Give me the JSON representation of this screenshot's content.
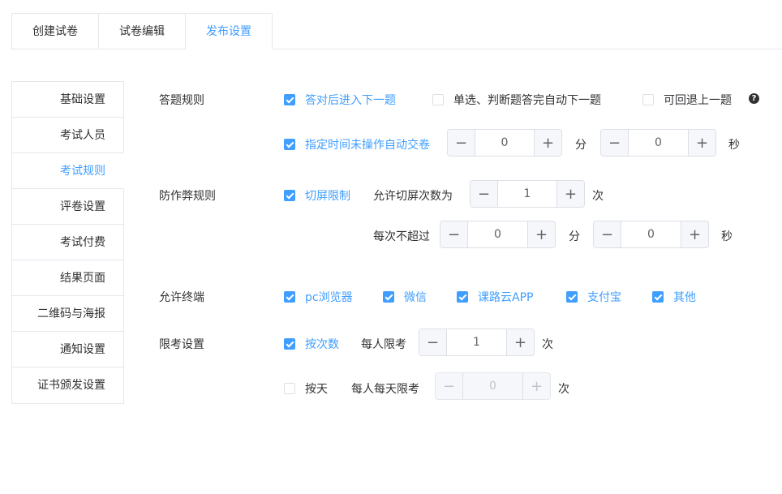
{
  "tabs": [
    {
      "label": "创建试卷"
    },
    {
      "label": "试卷编辑"
    },
    {
      "label": "发布设置"
    }
  ],
  "sidebar": {
    "items": [
      {
        "label": "基础设置"
      },
      {
        "label": "考试人员"
      },
      {
        "label": "考试规则"
      },
      {
        "label": "评卷设置"
      },
      {
        "label": "考试付费"
      },
      {
        "label": "结果页面"
      },
      {
        "label": "二维码与海报"
      },
      {
        "label": "通知设置"
      },
      {
        "label": "证书颁发设置"
      }
    ],
    "active_index": 2
  },
  "answer_rules": {
    "label": "答题规则",
    "next_after_correct": {
      "label": "答对后进入下一题",
      "checked": true
    },
    "auto_next": {
      "label": "单选、判断题答完自动下一题",
      "checked": false
    },
    "allow_back": {
      "label": "可回退上一题",
      "checked": false
    },
    "help_icon": "question-circle-icon",
    "auto_submit": {
      "label": "指定时间未操作自动交卷",
      "checked": true
    },
    "auto_submit_minutes": "0",
    "auto_submit_seconds": "0",
    "unit_min": "分",
    "unit_sec": "秒"
  },
  "anti_cheat": {
    "label": "防作弊规则",
    "switch_limit": {
      "label": "切屏限制",
      "checked": true
    },
    "allowed_text": "允许切屏次数为",
    "allowed_count": "1",
    "unit_times": "次",
    "each_max_text": "每次不超过",
    "each_minutes": "0",
    "each_seconds": "0",
    "unit_min": "分",
    "unit_sec": "秒"
  },
  "terminals": {
    "label": "允许终端",
    "options": [
      {
        "label": "pc浏览器",
        "checked": true
      },
      {
        "label": "微信",
        "checked": true
      },
      {
        "label": "课路云APP",
        "checked": true
      },
      {
        "label": "支付宝",
        "checked": true
      },
      {
        "label": "其他",
        "checked": true
      }
    ]
  },
  "limit": {
    "label": "限考设置",
    "by_count": {
      "label": "按次数",
      "checked": true
    },
    "per_person_text": "每人限考",
    "per_person_value": "1",
    "unit_times": "次",
    "by_day": {
      "label": "按天",
      "checked": false
    },
    "per_day_text": "每人每天限考",
    "per_day_value": "0",
    "unit_times2": "次"
  },
  "colors": {
    "accent": "#409eff",
    "border": "#dcdfe6",
    "text": "#303133"
  }
}
